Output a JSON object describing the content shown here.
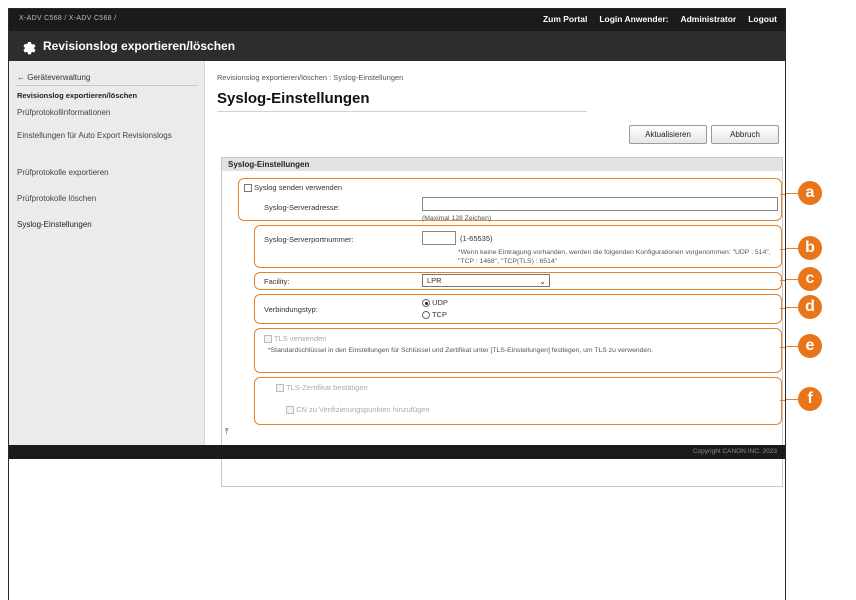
{
  "header": {
    "device_name": "X-ADV C568 / X-ADV C568 /",
    "links": [
      "Zum Portal",
      "Login Anwender:",
      "Administrator",
      "Logout"
    ]
  },
  "title": {
    "icon": "gear-icon",
    "text": "Revisionslog exportieren/löschen"
  },
  "sidebar": {
    "back_label": "← Geräteverwaltung",
    "section_label": "Revisionslog exportieren/löschen",
    "items": [
      {
        "label": "Prüfprotokollinformationen"
      },
      {
        "label": "Einstellungen für Auto Export Revisionslogs"
      },
      {
        "label": "Prüfprotokolle exportieren"
      },
      {
        "label": "Prüfprotokolle löschen"
      },
      {
        "label": "Syslog-Einstellungen"
      }
    ]
  },
  "main": {
    "breadcrumb": "Revisionslog exportieren/löschen : Syslog-Einstellungen",
    "heading": "Syslog-Einstellungen",
    "buttons": {
      "refresh": "Aktualisieren",
      "cancel": "Abbruch"
    },
    "section_title": "Syslog-Einstellungen",
    "use_syslog_label": "Syslog senden verwenden",
    "server_address_label": "Syslog-Serveradresse:",
    "server_address_value": "",
    "server_address_hint": "(Maximal 128 Zeichen)",
    "port_label": "Syslog-Serverportnummer:",
    "port_value": "",
    "port_range": "(1-65535)",
    "port_note": "*Wenn keine Eintragung vorhanden, werden die folgenden Konfigurationen vorgenommen: \"UDP : 514\", \"TCP : 1468\", \"TCP(TLS) : 6514\"",
    "facility_label": "Facility:",
    "facility_value": "LPR",
    "connection_label": "Verbindungstyp:",
    "connection_options": [
      "UDP",
      "TCP"
    ],
    "connection_selected": "UDP",
    "tls_label": "TLS verwenden",
    "tls_note": "*Standardschlüssel in den Einstellungen für Schlüssel und Zertifikat unter [TLS-Einstellungen] festlegen, um TLS zu verwenden.",
    "tls_cert_label": "TLS-Zertifikat bestätigen",
    "cn_label": "CN zu Verifizierungspunkten hinzufügen"
  },
  "callouts": [
    "a",
    "b",
    "c",
    "d",
    "e",
    "f"
  ],
  "scroll_top_label": "⤒",
  "footer": {
    "copyright": "Copyright CANON INC. 2023"
  },
  "colors": {
    "accent": "#e8751a",
    "topbar": "#1b1b1b",
    "titlebar": "#2d2d2d",
    "sidebar": "#ebebeb"
  }
}
